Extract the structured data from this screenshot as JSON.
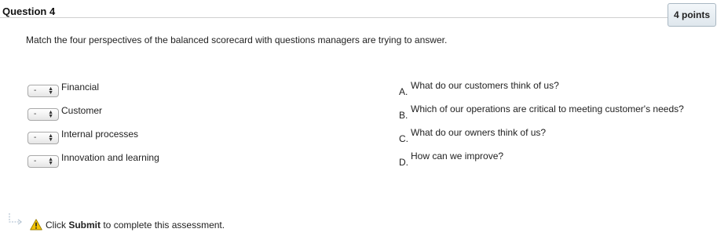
{
  "question": {
    "title": "Question 4",
    "points": "4 points",
    "prompt": "Match the four perspectives of the balanced scorecard with questions managers are trying to answer."
  },
  "items": [
    {
      "select_value": "-",
      "label": "Financial"
    },
    {
      "select_value": "-",
      "label": "Customer"
    },
    {
      "select_value": "-",
      "label": "Internal processes"
    },
    {
      "select_value": "-",
      "label": "Innovation and learning"
    }
  ],
  "answers": [
    {
      "letter": "A.",
      "text": "What do our customers think of us?"
    },
    {
      "letter": "B.",
      "text": "Which of our operations are critical to meeting customer's needs?"
    },
    {
      "letter": "C.",
      "text": "What do our owners think of us?"
    },
    {
      "letter": "D.",
      "text": "How can we improve?"
    }
  ],
  "footer": {
    "prefix": "Click ",
    "submit": "Submit",
    "suffix": " to complete this assessment."
  },
  "icons": {
    "arrow": "arrow-right-icon",
    "warning": "warning-icon",
    "select_arrows": "updown-arrows-icon"
  },
  "colors": {
    "badge_border": "#a9b7c2",
    "warning": "#f2c200"
  }
}
